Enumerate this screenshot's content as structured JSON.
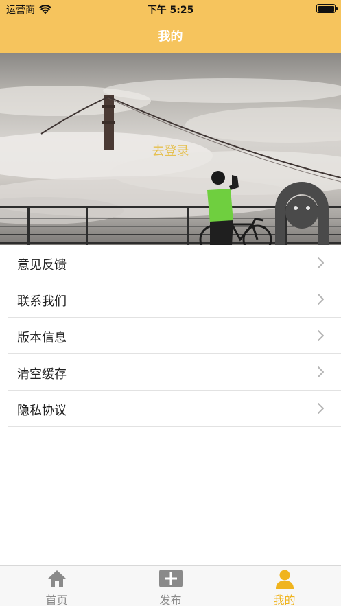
{
  "status_bar": {
    "carrier": "运营商",
    "time": "下午 5:25"
  },
  "nav": {
    "title": "我的"
  },
  "profile": {
    "login_text": "去登录"
  },
  "menu": [
    {
      "label": "意见反馈"
    },
    {
      "label": "联系我们"
    },
    {
      "label": "版本信息"
    },
    {
      "label": "清空缓存"
    },
    {
      "label": "隐私协议"
    }
  ],
  "tabs": [
    {
      "label": "首页",
      "icon": "home-icon",
      "active": false
    },
    {
      "label": "发布",
      "icon": "plus-square-icon",
      "active": false
    },
    {
      "label": "我的",
      "icon": "person-icon",
      "active": true
    }
  ],
  "colors": {
    "accent": "#f6c45d",
    "tab_active": "#f0b41e",
    "tab_inactive": "#8a8a8a",
    "login_text": "#e5c050"
  }
}
